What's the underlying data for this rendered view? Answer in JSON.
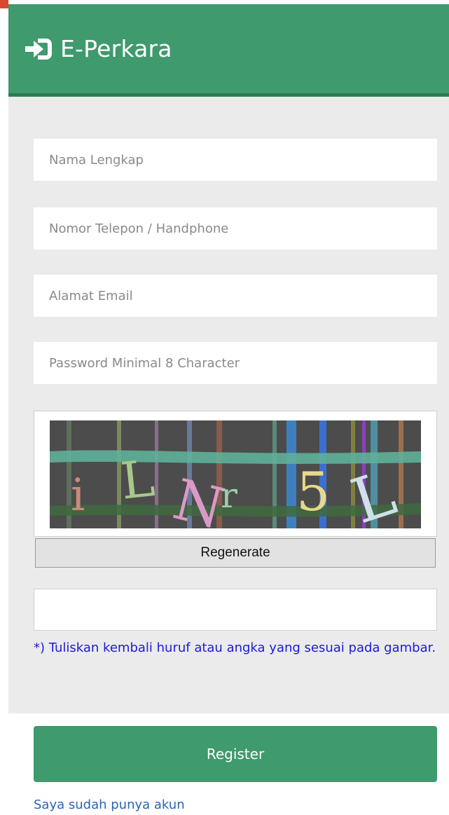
{
  "header": {
    "title": "E-Perkara",
    "icon": "login-enter-icon"
  },
  "form": {
    "nama_placeholder": "Nama Lengkap",
    "telepon_placeholder": "Nomor Telepon / Handphone",
    "email_placeholder": "Alamat Email",
    "password_placeholder": "Password Minimal 8 Character",
    "captcha": {
      "regenerate_label": "Regenerate",
      "input_value": "",
      "hint": "*) Tuliskan kembali huruf atau angka yang sesuai pada gambar."
    },
    "register_label": "Register",
    "login_link": "Saya sudah punya akun"
  },
  "colors": {
    "brand_green": "#3f9a6e",
    "card_bg": "#ebebeb",
    "hint_blue": "#1a1adb",
    "link_blue": "#2a64b5"
  }
}
